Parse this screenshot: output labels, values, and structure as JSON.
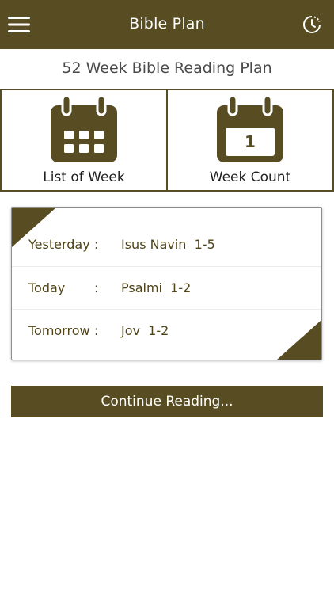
{
  "header": {
    "title": "Bible Plan",
    "menu_icon": "hamburger-menu-icon",
    "history_icon": "clock-history-icon"
  },
  "plan_title": "52 Week Bible Reading Plan",
  "tiles": [
    {
      "label": "List of Week",
      "icon": "calendar-grid-icon"
    },
    {
      "label": "Week Count",
      "icon": "calendar-count-icon",
      "count": "1"
    }
  ],
  "readings": [
    {
      "day": "Yesterday",
      "colon": ":",
      "passage": "Isus Navin  1-5"
    },
    {
      "day": "Today",
      "colon": ":",
      "passage": "Psalmi  1-2"
    },
    {
      "day": "Tomorrow",
      "colon": ":",
      "passage": "Jov  1-2"
    }
  ],
  "continue_label": "Continue Reading...",
  "colors": {
    "brand": "#584d22",
    "text_dark": "#4f4418",
    "background": "#ffffff"
  }
}
